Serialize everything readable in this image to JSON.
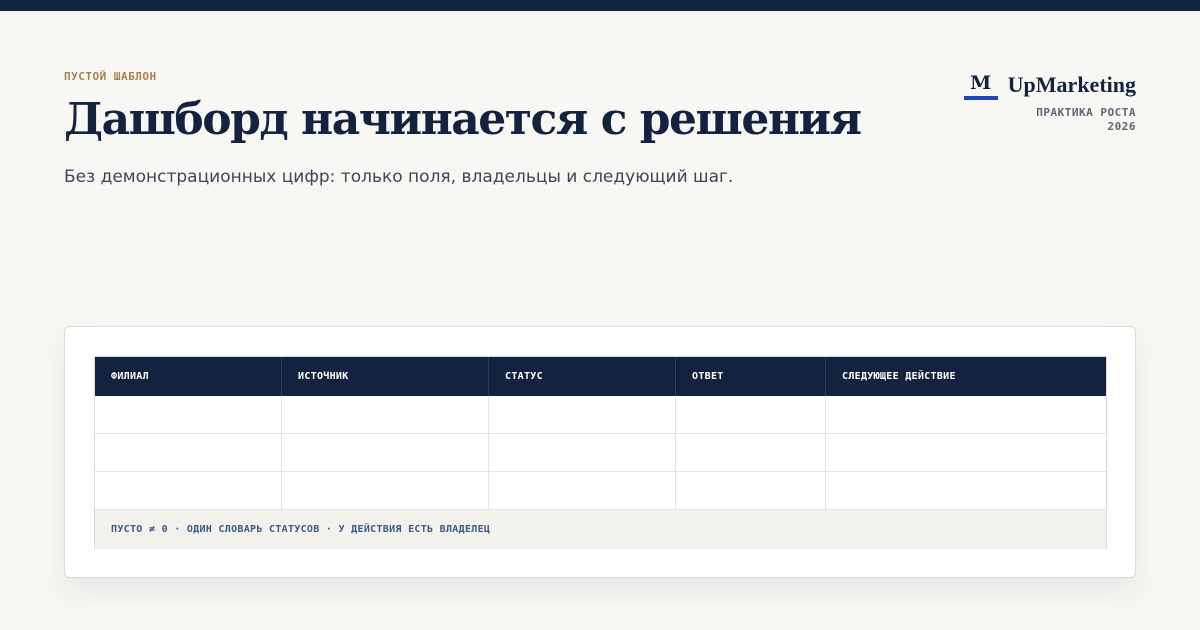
{
  "header": {
    "eyebrow": "ПУСТОЙ ШАБЛОН",
    "title": "Дашборд начинается с решения",
    "subtitle": "Без демонстрационных цифр: только поля, владельцы и следующий шаг."
  },
  "brand": {
    "mark": "M",
    "name": "UpMarketing",
    "line1": "ПРАКТИКА РОСТА",
    "line2": "2026",
    "accent_color": "#2247b3"
  },
  "table": {
    "columns": [
      "ФИЛИАЛ",
      "ИСТОЧНИК",
      "СТАТУС",
      "ОТВЕТ",
      "СЛЕДУЮЩЕЕ ДЕЙСТВИЕ"
    ],
    "rows": [
      [
        "",
        "",
        "",
        "",
        ""
      ],
      [
        "",
        "",
        "",
        "",
        ""
      ],
      [
        "",
        "",
        "",
        "",
        ""
      ]
    ],
    "footer": "ПУСТО ≠ 0 · ОДИН СЛОВАРЬ СТАТУСОВ · У ДЕЙСТВИЯ ЕСТЬ ВЛАДЕЛЕЦ"
  },
  "colors": {
    "navy": "#13233f",
    "gold": "#a9804a",
    "background": "#f8f7f4"
  }
}
